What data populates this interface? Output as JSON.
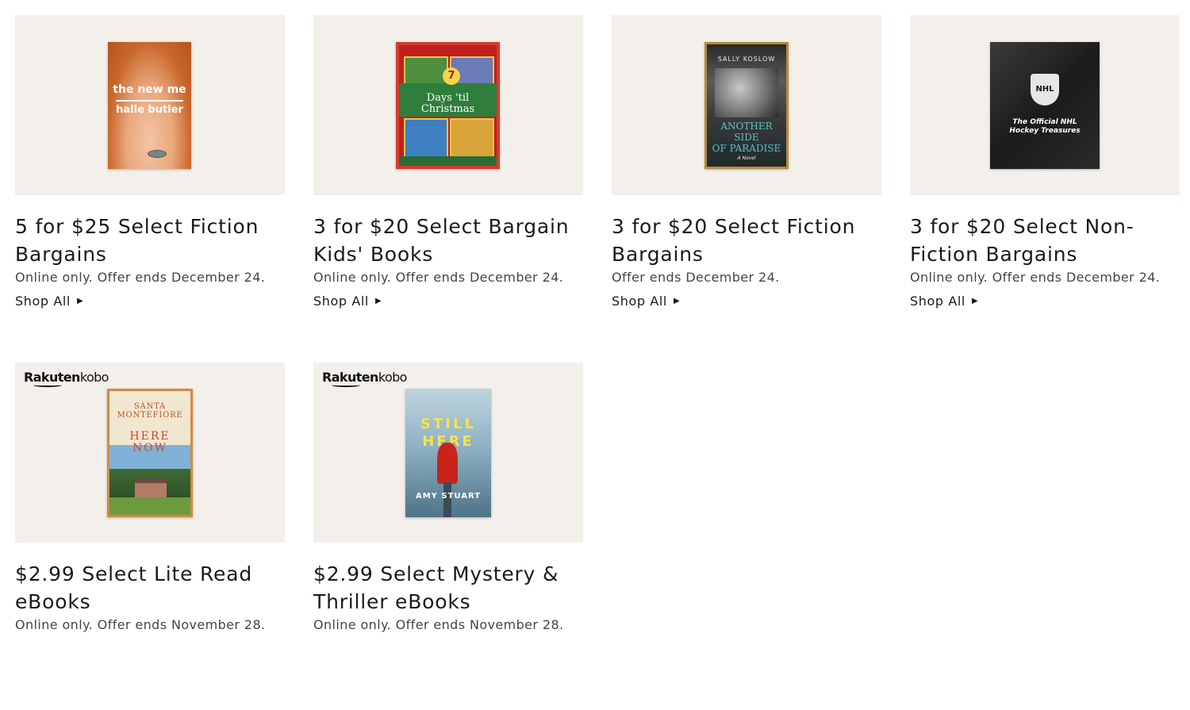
{
  "cards": [
    {
      "title": "5 for $25 Select Fiction Bargains",
      "subtitle": "Online only. Offer ends December 24.",
      "link": "Shop All",
      "cover": {
        "line1": "the new me",
        "line2": "halle butler"
      }
    },
    {
      "title": "3 for $20 Select Bargain Kids' Books",
      "subtitle": "Online only. Offer ends December 24.",
      "link": "Shop All",
      "cover": {
        "number": "7",
        "line1": "Days 'til",
        "line2": "Christmas"
      }
    },
    {
      "title": "3 for $20 Select Fiction Bargains",
      "subtitle": "Offer ends December 24.",
      "link": "Shop All",
      "cover": {
        "author": "SALLY KOSLOW",
        "line1": "ANOTHER SIDE",
        "line2": "OF PARADISE",
        "note": "A Novel"
      }
    },
    {
      "title": "3 for $20 Select Non-Fiction Bargains",
      "subtitle": "Online only. Offer ends December 24.",
      "link": "Shop All",
      "cover": {
        "badge": "NHL",
        "line1": "The Official NHL",
        "line2": "Hockey Treasures"
      }
    },
    {
      "title": "$2.99 Select Lite Read eBooks",
      "subtitle": "Online only. Offer ends November 28.",
      "brand": "Rakuten",
      "brand2": "kobo",
      "cover": {
        "author1": "SANTA",
        "author2": "MONTEFIORE",
        "line1": "HERE",
        "line2": "NOW"
      }
    },
    {
      "title": "$2.99 Select Mystery & Thriller eBooks",
      "subtitle": "Online only. Offer ends November 28.",
      "brand": "Rakuten",
      "brand2": "kobo",
      "cover": {
        "line1": "STILL",
        "line2": "HERE",
        "author": "AMY STUART"
      }
    }
  ],
  "colors": {
    "tile_background": "#f3efea",
    "text": "#1a1a1a"
  },
  "icons": {
    "shop_arrow": "triangle-right-icon"
  }
}
